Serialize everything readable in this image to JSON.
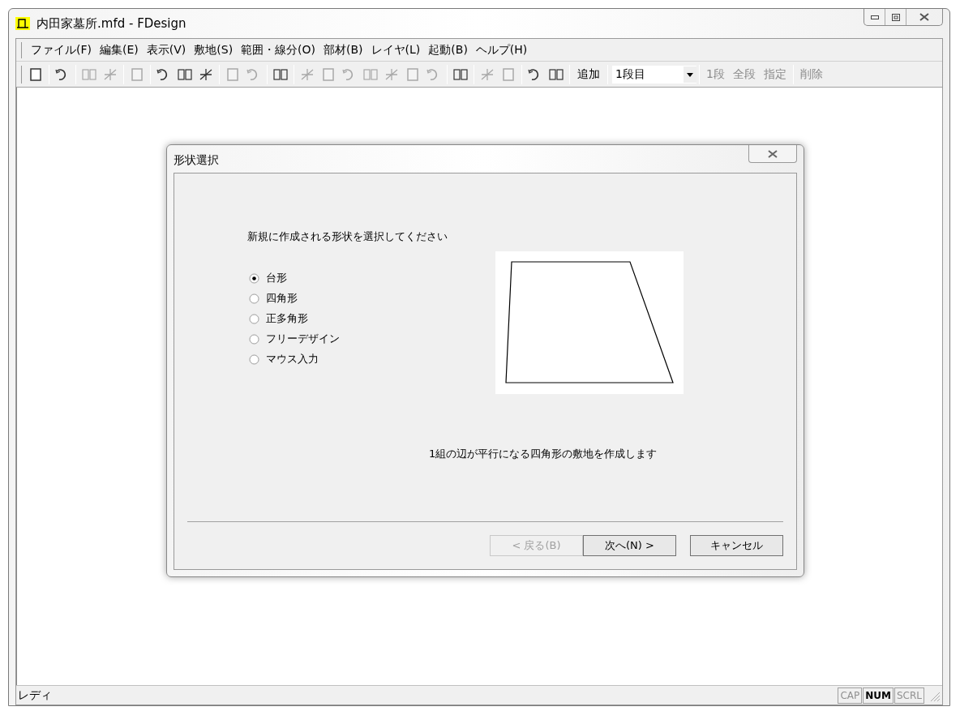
{
  "window": {
    "title": "内田家墓所.mfd - FDesign"
  },
  "menu": [
    "ファイル(F)",
    "編集(E)",
    "表示(V)",
    "敷地(S)",
    "範囲・線分(O)",
    "部材(B)",
    "レイヤ(L)",
    "起動(B)",
    "ヘルプ(H)"
  ],
  "toolbar": {
    "groups": [
      [
        {
          "disabled": false
        }
      ],
      [
        {
          "disabled": false
        }
      ],
      [
        {
          "disabled": true
        },
        {
          "disabled": true
        }
      ],
      [
        {
          "disabled": true
        }
      ],
      [
        {
          "disabled": false
        },
        {
          "disabled": false
        },
        {
          "disabled": false
        }
      ],
      [
        {
          "disabled": true
        },
        {
          "disabled": true
        }
      ],
      [
        {
          "disabled": false
        }
      ],
      [
        {
          "disabled": true
        },
        {
          "disabled": true
        },
        {
          "disabled": true
        },
        {
          "disabled": true
        },
        {
          "disabled": true
        },
        {
          "disabled": true
        },
        {
          "disabled": true
        }
      ],
      [
        {
          "disabled": false
        }
      ],
      [
        {
          "disabled": true
        },
        {
          "disabled": true
        }
      ],
      [
        {
          "disabled": false
        },
        {
          "disabled": false
        }
      ]
    ],
    "add": {
      "label": "追加",
      "disabled": false
    },
    "level_select": {
      "value": "1段目"
    },
    "scope_buttons": [
      {
        "label": "1段",
        "disabled": true
      },
      {
        "label": "全段",
        "disabled": true
      },
      {
        "label": "指定",
        "disabled": true
      }
    ],
    "delete": {
      "label": "削除",
      "disabled": true
    }
  },
  "dialog": {
    "title": "形状選択",
    "prompt": "新規に作成される形状を選択してください",
    "options": [
      {
        "label": "台形",
        "selected": true
      },
      {
        "label": "四角形",
        "selected": false
      },
      {
        "label": "正多角形",
        "selected": false
      },
      {
        "label": "フリーデザイン",
        "selected": false
      },
      {
        "label": "マウス入力",
        "selected": false
      }
    ],
    "description": "1組の辺が平行になる四角形の敷地を作成します",
    "buttons": [
      {
        "label": "< 戻る(B)",
        "disabled": true
      },
      {
        "label": "次へ(N) >",
        "disabled": false
      },
      {
        "label": "キャンセル",
        "disabled": false
      }
    ]
  },
  "status_bar": {
    "text": "レディ",
    "indicators": [
      {
        "label": "CAP",
        "on": false
      },
      {
        "label": "NUM",
        "on": true
      },
      {
        "label": "SCRL",
        "on": false
      }
    ]
  }
}
